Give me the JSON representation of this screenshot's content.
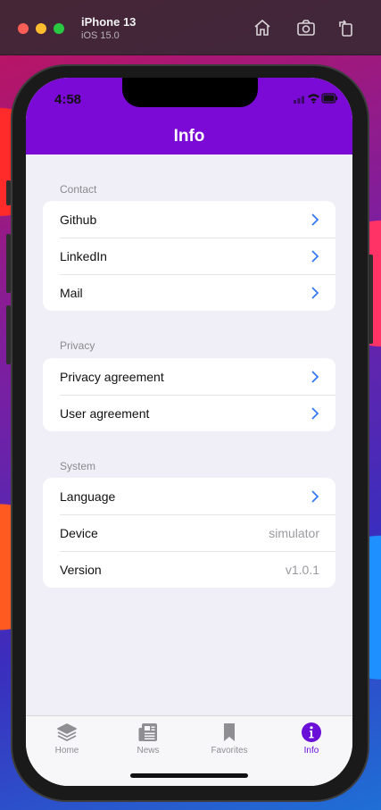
{
  "simulator": {
    "device_name": "iPhone 13",
    "os_version": "iOS 15.0",
    "toolbar_icons": [
      "home-icon",
      "screenshot-icon",
      "rotate-icon"
    ]
  },
  "status_bar": {
    "time": "4:58"
  },
  "nav": {
    "title": "Info"
  },
  "sections": {
    "contact": {
      "title": "Contact",
      "items": [
        {
          "label": "Github",
          "chevron": true
        },
        {
          "label": "LinkedIn",
          "chevron": true
        },
        {
          "label": "Mail",
          "chevron": true
        }
      ]
    },
    "privacy": {
      "title": "Privacy",
      "items": [
        {
          "label": "Privacy agreement",
          "chevron": true
        },
        {
          "label": "User agreement",
          "chevron": true
        }
      ]
    },
    "system": {
      "title": "System",
      "items": [
        {
          "label": "Language",
          "chevron": true
        },
        {
          "label": "Device",
          "value": "simulator"
        },
        {
          "label": "Version",
          "value": "v1.0.1"
        }
      ]
    }
  },
  "tabbar": {
    "items": [
      {
        "label": "Home",
        "icon": "layers-icon",
        "active": false
      },
      {
        "label": "News",
        "icon": "newspaper-icon",
        "active": false
      },
      {
        "label": "Favorites",
        "icon": "bookmark-icon",
        "active": false
      },
      {
        "label": "Info",
        "icon": "info-icon",
        "active": true
      }
    ]
  },
  "colors": {
    "accent": "#7b0ad6",
    "chevron": "#3478f6",
    "background": "#f0eef6"
  }
}
